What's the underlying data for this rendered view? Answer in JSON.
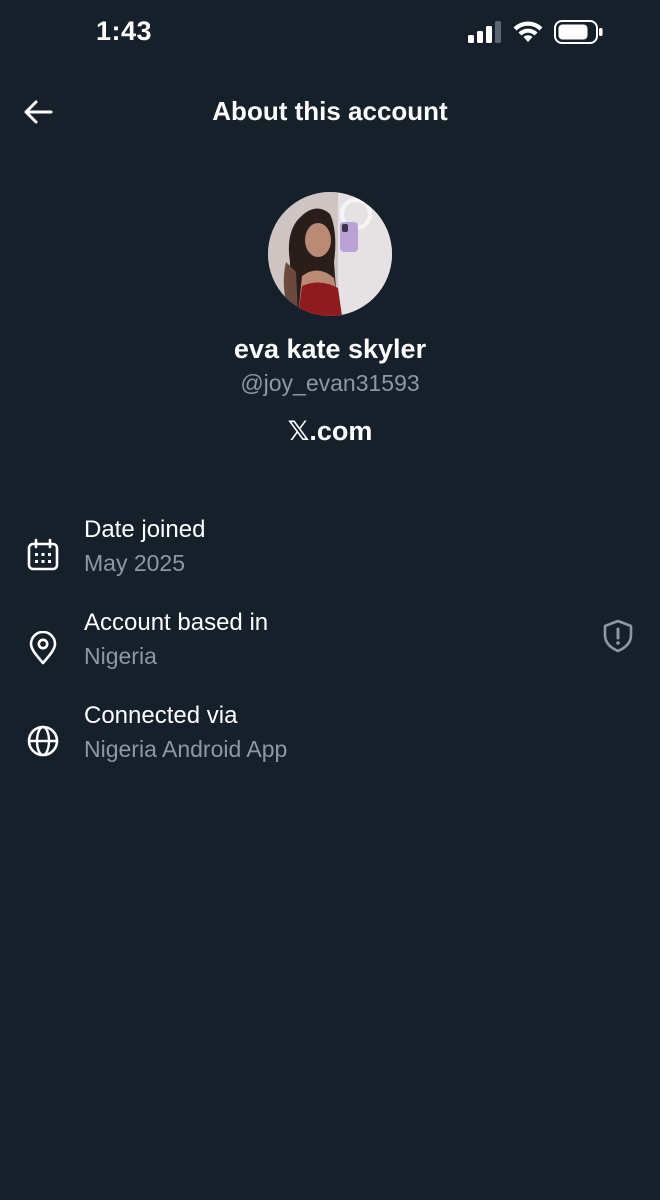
{
  "status_bar": {
    "time": "1:43"
  },
  "header": {
    "title": "About this account",
    "back_icon": "arrow-left-icon"
  },
  "profile": {
    "display_name": "eva kate skyler",
    "handle": "@joy_evan31593",
    "domain": "𝕏.com"
  },
  "info": {
    "date_joined": {
      "label": "Date joined",
      "value": "May 2025",
      "icon": "calendar-icon"
    },
    "based_in": {
      "label": "Account based in",
      "value": "Nigeria",
      "icon": "location-pin-icon",
      "extra_icon": "shield-alert-icon"
    },
    "connected_via": {
      "label": "Connected via",
      "value": "Nigeria Android App",
      "icon": "globe-icon"
    }
  },
  "colors": {
    "background": "#16202a",
    "primary_text": "#ffffff",
    "secondary_text": "#8b98a5"
  }
}
